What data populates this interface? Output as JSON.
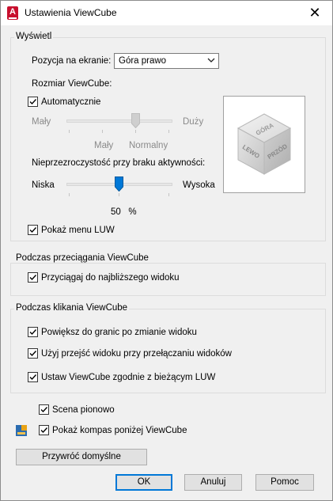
{
  "window": {
    "title": "Ustawienia ViewCube",
    "icon_letter": "A",
    "close_glyph": "✕"
  },
  "display": {
    "legend": "Wyświetl",
    "position_label": "Pozycja na ekranie:",
    "position_value": "Góra prawo",
    "size_label": "Rozmiar ViewCube:",
    "auto_label": "Automatycznie",
    "auto_checked": true,
    "size_min": "Mały",
    "size_max": "Duży",
    "size_current": "Mały",
    "size_current2": "Normalny",
    "size_level": 0.67,
    "opacity_label": "Nieprzezroczystość przy braku aktywności:",
    "opacity_min": "Niska",
    "opacity_max": "Wysoka",
    "opacity_value": "50",
    "opacity_unit": "%",
    "opacity_level": 0.5,
    "show_ucs_menu_label": "Pokaż menu LUW",
    "show_ucs_menu_checked": true
  },
  "preview": {
    "top_face": "GÓRA",
    "left_face": "LEWO",
    "front_face": "PRZÓD"
  },
  "dragging": {
    "legend": "Podczas przeciągania ViewCube",
    "snap_label": "Przyciągaj do najbliższego widoku",
    "snap_checked": true
  },
  "clicking": {
    "legend": "Podczas klikania ViewCube",
    "zoom_label": "Powiększ do granic po zmianie widoku",
    "zoom_checked": true,
    "transition_label": "Użyj przejść widoku przy przełączaniu widoków",
    "transition_checked": true,
    "orient_label": "Ustaw ViewCube zgodnie z bieżącym LUW",
    "orient_checked": true
  },
  "extra": {
    "scene_upright_label": "Scena pionowo",
    "scene_upright_checked": true,
    "show_compass_label": "Pokaż kompas poniżej ViewCube",
    "show_compass_checked": true
  },
  "buttons": {
    "restore": "Przywróć domyślne",
    "ok": "OK",
    "cancel": "Anuluj",
    "help": "Pomoc"
  },
  "colors": {
    "accent": "#0078d7",
    "brand": "#c8102e"
  }
}
